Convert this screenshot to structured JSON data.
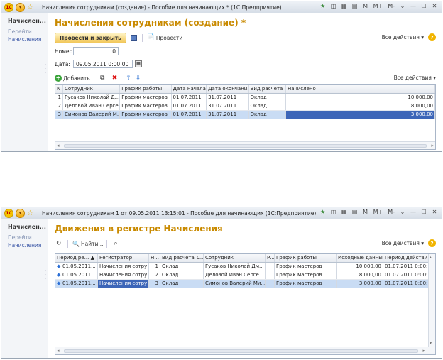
{
  "colors": {
    "title_accent": "#c98a00",
    "link": "#3a56a6",
    "selection": "#3d66b8",
    "row_selected": "#c9dcf4"
  },
  "window1": {
    "title": "Начисления сотрудникам (создание) - Пособие для начинающих * (1С:Предприятие)",
    "titlebar_buttons": [
      "M",
      "M+",
      "M-",
      "⌄",
      "—",
      "☐",
      "✕"
    ],
    "sidebar": {
      "title": "Начислен...",
      "links": [
        "Перейти",
        "Начисления"
      ]
    },
    "doc_title": "Начисления сотрудникам (создание) *",
    "toolbar": {
      "post_and_close": "Провести и закрыть",
      "post": "Провести",
      "all_actions": "Все действия ▾",
      "help": "?"
    },
    "number_label": "Номер:",
    "number_value": "0",
    "date_label": "Дата:",
    "date_value": "09.05.2011  0:00:00",
    "table_toolbar": {
      "add": "Добавить",
      "all_actions": "Все действия ▾"
    },
    "table": {
      "headers": [
        "N",
        "Сотрудник",
        "График работы",
        "Дата начала",
        "Дата окончания",
        "Вид расчета",
        "Начислено"
      ],
      "rows": [
        [
          "1",
          "Гусаков Николай Д...",
          "График мастеров",
          "01.07.2011",
          "31.07.2011",
          "Оклад",
          "10 000,00"
        ],
        [
          "2",
          "Деловой Иван Серге...",
          "График мастеров",
          "01.07.2011",
          "31.07.2011",
          "Оклад",
          "8 000,00"
        ],
        [
          "3",
          "Симонов Валерий М...",
          "График мастеров",
          "01.07.2011",
          "31.07.2011",
          "Оклад",
          "3 000,00"
        ]
      ],
      "selected_row": 2
    }
  },
  "window2": {
    "title": "Начисления сотрудникам 1 от 09.05.2011 13:15:01 - Пособие для начинающих (1С:Предприятие)",
    "titlebar_buttons": [
      "M",
      "M+",
      "M-",
      "⌄",
      "—",
      "☐",
      "✕"
    ],
    "sidebar": {
      "title": "Начислен...",
      "links": [
        "Перейти",
        "Начисления"
      ]
    },
    "doc_title": "Движения в регистре Начисления",
    "toolbar": {
      "find": "Найти...",
      "all_actions": "Все действия ▾",
      "help": "?"
    },
    "table": {
      "headers": [
        "Период ре...",
        "Регистратор",
        "Н...",
        "Вид расчета",
        "С...",
        "Сотрудник",
        "Р...",
        "График работы",
        "Исходные данные",
        "Период действия"
      ],
      "rows": [
        [
          "01.05.2011...",
          "Начисления сотру...",
          "1",
          "Оклад",
          "",
          "Гусаков Николай Дм...",
          "",
          "График мастеров",
          "10 000,00",
          "01.07.2011 0:00:0"
        ],
        [
          "01.05.2011...",
          "Начисления сотру...",
          "2",
          "Оклад",
          "",
          "Деловой Иван Серге...",
          "",
          "График мастеров",
          "8 000,00",
          "01.07.2011 0:00:0"
        ],
        [
          "01.05.2011...",
          "Начисления сотру...",
          "3",
          "Оклад",
          "",
          "Симонов Валерий Ми...",
          "",
          "График мастеров",
          "3 000,00",
          "01.07.2011 0:00:0"
        ]
      ],
      "selected_row": 2
    }
  }
}
